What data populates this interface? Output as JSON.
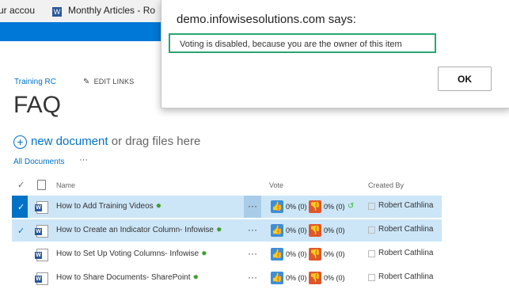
{
  "bookmarks": {
    "item1": "ur accou",
    "item2_icon": "W",
    "item2": "Monthly Articles - Ro"
  },
  "breadcrumb": "Training RC",
  "edit_links": "EDIT LINKS",
  "page_title": "FAQ",
  "new_document": {
    "link": "new document",
    "rest": " or drag files here"
  },
  "view": {
    "label": "All Documents",
    "more": "···"
  },
  "columns": {
    "name": "Name",
    "vote": "Vote",
    "created_by": "Created By"
  },
  "rows": [
    {
      "name": "How to Add Training Videos",
      "up": "0% (0)",
      "down": "0% (0)",
      "author": "Robert Cathlina",
      "dots": "···"
    },
    {
      "name": "How to Create an Indicator Column- Infowise",
      "up": "0% (0)",
      "down": "0% (0)",
      "author": "Robert Cathlina",
      "dots": "···"
    },
    {
      "name": "How to Set Up Voting Columns- Infowise",
      "up": "0% (0)",
      "down": "0% (0)",
      "author": "Robert Cathlina",
      "dots": "···"
    },
    {
      "name": "How to Share Documents- SharePoint",
      "up": "0% (0)",
      "down": "0% (0)",
      "author": "Robert Cathlina",
      "dots": "···"
    }
  ],
  "dialog": {
    "title": "demo.infowisesolutions.com says:",
    "message": "Voting is disabled, because you are the owner of this item",
    "ok": "OK"
  },
  "colors": {
    "suite_bar": "#0078d7",
    "accent": "#0072c6",
    "highlight_border": "#2aa572"
  }
}
